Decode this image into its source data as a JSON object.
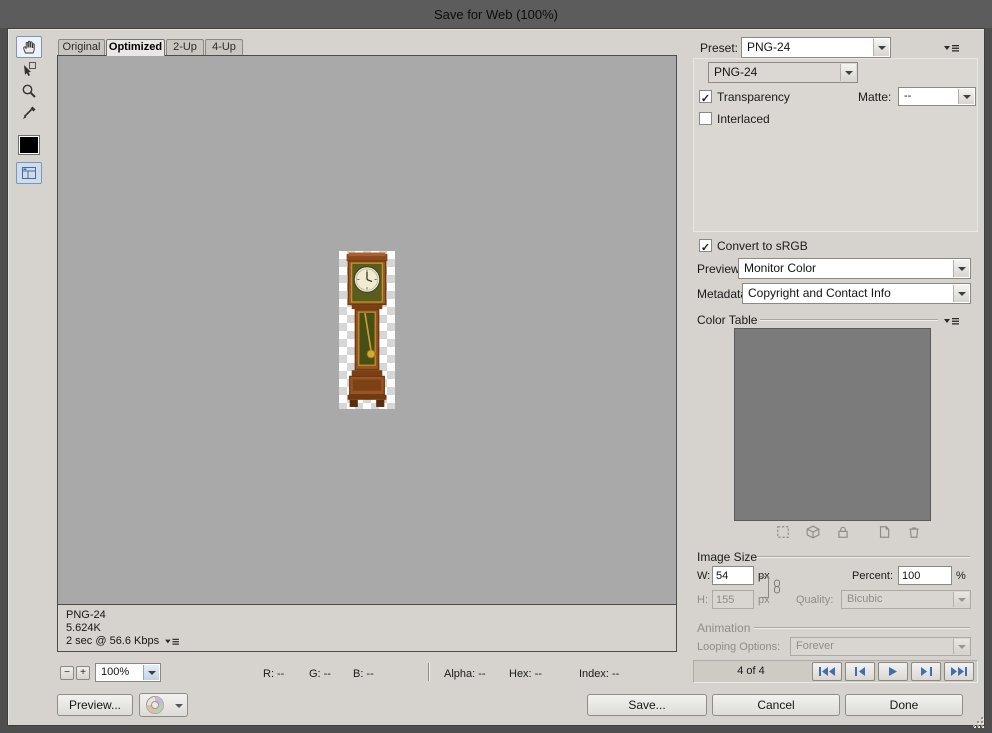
{
  "title": "Save for Web (100%)",
  "icons": {
    "check": "✓"
  },
  "tabs": [
    {
      "label": "Original",
      "active": false
    },
    {
      "label": "Optimized",
      "active": true
    },
    {
      "label": "2-Up",
      "active": false
    },
    {
      "label": "4-Up",
      "active": false
    }
  ],
  "toolbar": {
    "eyedropper_color": "#000000",
    "tools": [
      {
        "name": "hand-tool",
        "selected": true
      },
      {
        "name": "slice-select-tool",
        "selected": false
      },
      {
        "name": "zoom-tool",
        "selected": false
      },
      {
        "name": "eyedropper-tool",
        "selected": false
      },
      {
        "name": "toggle-slices",
        "selected": true
      }
    ]
  },
  "preview": {
    "image": "grandfather-clock",
    "info": {
      "format": "PNG-24",
      "size": "5.624K",
      "time": "2 sec @ 56.6 Kbps"
    }
  },
  "statusbar": {
    "zoom_out": "−",
    "zoom_in": "+",
    "zoom_level": "100%",
    "readouts": [
      {
        "label": "R:",
        "value": "--"
      },
      {
        "label": "G:",
        "value": "--"
      },
      {
        "label": "B:",
        "value": "--"
      },
      {
        "label": "Alpha:",
        "value": "--"
      },
      {
        "label": "Hex:",
        "value": "--"
      },
      {
        "label": "Index:",
        "value": "--"
      }
    ]
  },
  "settings": {
    "preset_label": "Preset:",
    "preset_value": "PNG-24",
    "format_value": "PNG-24",
    "transparency": {
      "label": "Transparency",
      "checked": true
    },
    "matte": {
      "label": "Matte:",
      "value": "--"
    },
    "interlaced": {
      "label": "Interlaced",
      "checked": false
    },
    "srgb": {
      "label": "Convert to sRGB",
      "checked": true
    },
    "preview": {
      "label": "Preview:",
      "value": "Monitor Color"
    },
    "metadata": {
      "label": "Metadata:",
      "value": "Copyright and Contact Info"
    }
  },
  "color_table": {
    "title": "Color Table"
  },
  "image_size": {
    "title": "Image Size",
    "w_label": "W:",
    "w_value": "54",
    "w_unit": "px",
    "h_label": "H:",
    "h_value": "155",
    "h_unit": "px",
    "percent_label": "Percent:",
    "percent_value": "100",
    "percent_unit": "%",
    "quality_label": "Quality:",
    "quality_value": "Bicubic"
  },
  "animation": {
    "title": "Animation",
    "looping_label": "Looping Options:",
    "looping_value": "Forever",
    "frame_counter": "4 of 4"
  },
  "footer": {
    "preview_button": "Preview...",
    "save_button": "Save...",
    "cancel_button": "Cancel",
    "done_button": "Done"
  }
}
